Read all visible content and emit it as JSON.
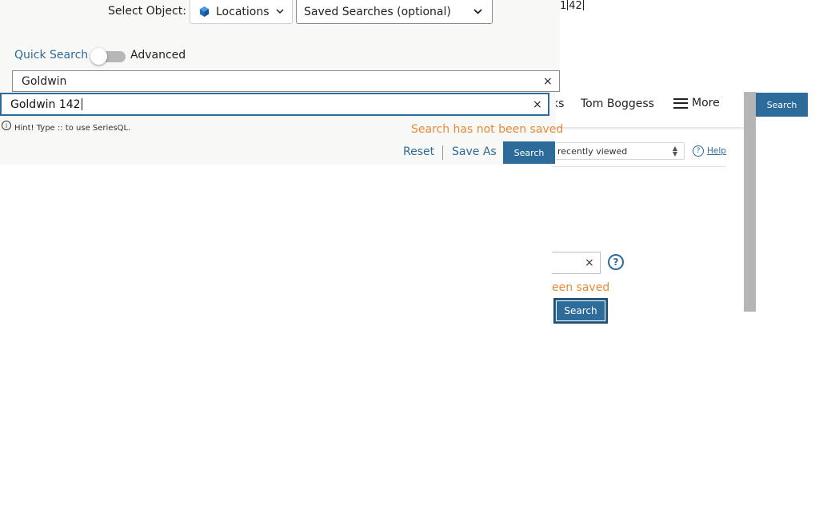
{
  "background": {
    "nav_partial": "ks",
    "user_name": "Tom Boggess",
    "more_label": "More",
    "search_label": "Search",
    "recent_select": "recently viewed",
    "help_label": "Help",
    "help_icon": "?",
    "clear_icon": "×",
    "question_icon": "?",
    "not_saved": "een saved",
    "search_button": "Search"
  },
  "stray": {
    "left": "1",
    "right": "42"
  },
  "search": {
    "select_object_label": "Select Object:",
    "object_value": "Locations",
    "saved_searches_placeholder": "Saved Searches (optional)",
    "quick_search_label": "Quick Search",
    "advanced_label": "Advanced",
    "toggle_on": false,
    "query_1": "Goldwin",
    "query_2": "Goldwin 142",
    "clear_icon": "×",
    "hint_icon": "i",
    "hint": "Hint! Type :: to use SeriesQL.",
    "status": "Search has not been saved",
    "reset_label": "Reset",
    "save_as_label": "Save As",
    "search_label": "Search"
  },
  "colors": {
    "accent": "#2d6b9a",
    "warning": "#e68a3a",
    "cube": "#1e6fc4"
  }
}
